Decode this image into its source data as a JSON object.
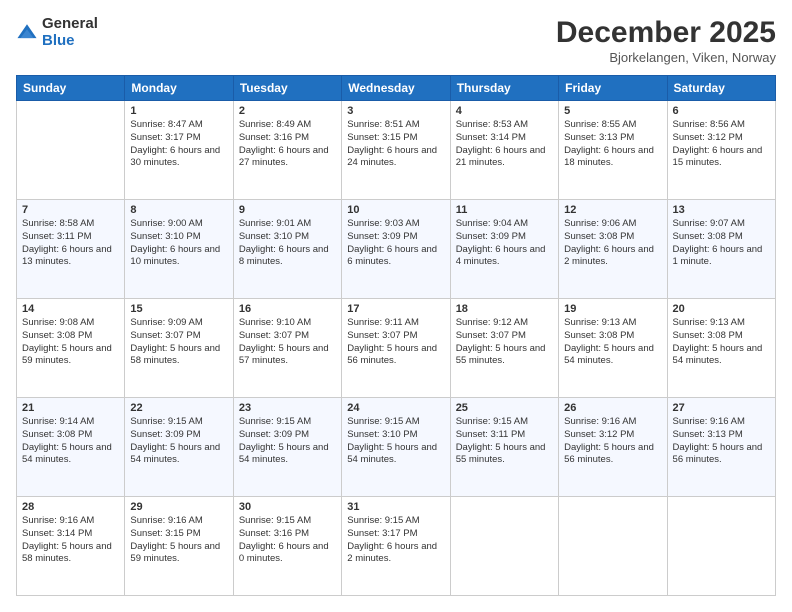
{
  "header": {
    "logo": {
      "general": "General",
      "blue": "Blue"
    },
    "title": "December 2025",
    "location": "Bjorkelangen, Viken, Norway"
  },
  "days_of_week": [
    "Sunday",
    "Monday",
    "Tuesday",
    "Wednesday",
    "Thursday",
    "Friday",
    "Saturday"
  ],
  "weeks": [
    [
      {
        "day": "",
        "sunrise": "",
        "sunset": "",
        "daylight": ""
      },
      {
        "day": "1",
        "sunrise": "Sunrise: 8:47 AM",
        "sunset": "Sunset: 3:17 PM",
        "daylight": "Daylight: 6 hours and 30 minutes."
      },
      {
        "day": "2",
        "sunrise": "Sunrise: 8:49 AM",
        "sunset": "Sunset: 3:16 PM",
        "daylight": "Daylight: 6 hours and 27 minutes."
      },
      {
        "day": "3",
        "sunrise": "Sunrise: 8:51 AM",
        "sunset": "Sunset: 3:15 PM",
        "daylight": "Daylight: 6 hours and 24 minutes."
      },
      {
        "day": "4",
        "sunrise": "Sunrise: 8:53 AM",
        "sunset": "Sunset: 3:14 PM",
        "daylight": "Daylight: 6 hours and 21 minutes."
      },
      {
        "day": "5",
        "sunrise": "Sunrise: 8:55 AM",
        "sunset": "Sunset: 3:13 PM",
        "daylight": "Daylight: 6 hours and 18 minutes."
      },
      {
        "day": "6",
        "sunrise": "Sunrise: 8:56 AM",
        "sunset": "Sunset: 3:12 PM",
        "daylight": "Daylight: 6 hours and 15 minutes."
      }
    ],
    [
      {
        "day": "7",
        "sunrise": "Sunrise: 8:58 AM",
        "sunset": "Sunset: 3:11 PM",
        "daylight": "Daylight: 6 hours and 13 minutes."
      },
      {
        "day": "8",
        "sunrise": "Sunrise: 9:00 AM",
        "sunset": "Sunset: 3:10 PM",
        "daylight": "Daylight: 6 hours and 10 minutes."
      },
      {
        "day": "9",
        "sunrise": "Sunrise: 9:01 AM",
        "sunset": "Sunset: 3:10 PM",
        "daylight": "Daylight: 6 hours and 8 minutes."
      },
      {
        "day": "10",
        "sunrise": "Sunrise: 9:03 AM",
        "sunset": "Sunset: 3:09 PM",
        "daylight": "Daylight: 6 hours and 6 minutes."
      },
      {
        "day": "11",
        "sunrise": "Sunrise: 9:04 AM",
        "sunset": "Sunset: 3:09 PM",
        "daylight": "Daylight: 6 hours and 4 minutes."
      },
      {
        "day": "12",
        "sunrise": "Sunrise: 9:06 AM",
        "sunset": "Sunset: 3:08 PM",
        "daylight": "Daylight: 6 hours and 2 minutes."
      },
      {
        "day": "13",
        "sunrise": "Sunrise: 9:07 AM",
        "sunset": "Sunset: 3:08 PM",
        "daylight": "Daylight: 6 hours and 1 minute."
      }
    ],
    [
      {
        "day": "14",
        "sunrise": "Sunrise: 9:08 AM",
        "sunset": "Sunset: 3:08 PM",
        "daylight": "Daylight: 5 hours and 59 minutes."
      },
      {
        "day": "15",
        "sunrise": "Sunrise: 9:09 AM",
        "sunset": "Sunset: 3:07 PM",
        "daylight": "Daylight: 5 hours and 58 minutes."
      },
      {
        "day": "16",
        "sunrise": "Sunrise: 9:10 AM",
        "sunset": "Sunset: 3:07 PM",
        "daylight": "Daylight: 5 hours and 57 minutes."
      },
      {
        "day": "17",
        "sunrise": "Sunrise: 9:11 AM",
        "sunset": "Sunset: 3:07 PM",
        "daylight": "Daylight: 5 hours and 56 minutes."
      },
      {
        "day": "18",
        "sunrise": "Sunrise: 9:12 AM",
        "sunset": "Sunset: 3:07 PM",
        "daylight": "Daylight: 5 hours and 55 minutes."
      },
      {
        "day": "19",
        "sunrise": "Sunrise: 9:13 AM",
        "sunset": "Sunset: 3:08 PM",
        "daylight": "Daylight: 5 hours and 54 minutes."
      },
      {
        "day": "20",
        "sunrise": "Sunrise: 9:13 AM",
        "sunset": "Sunset: 3:08 PM",
        "daylight": "Daylight: 5 hours and 54 minutes."
      }
    ],
    [
      {
        "day": "21",
        "sunrise": "Sunrise: 9:14 AM",
        "sunset": "Sunset: 3:08 PM",
        "daylight": "Daylight: 5 hours and 54 minutes."
      },
      {
        "day": "22",
        "sunrise": "Sunrise: 9:15 AM",
        "sunset": "Sunset: 3:09 PM",
        "daylight": "Daylight: 5 hours and 54 minutes."
      },
      {
        "day": "23",
        "sunrise": "Sunrise: 9:15 AM",
        "sunset": "Sunset: 3:09 PM",
        "daylight": "Daylight: 5 hours and 54 minutes."
      },
      {
        "day": "24",
        "sunrise": "Sunrise: 9:15 AM",
        "sunset": "Sunset: 3:10 PM",
        "daylight": "Daylight: 5 hours and 54 minutes."
      },
      {
        "day": "25",
        "sunrise": "Sunrise: 9:15 AM",
        "sunset": "Sunset: 3:11 PM",
        "daylight": "Daylight: 5 hours and 55 minutes."
      },
      {
        "day": "26",
        "sunrise": "Sunrise: 9:16 AM",
        "sunset": "Sunset: 3:12 PM",
        "daylight": "Daylight: 5 hours and 56 minutes."
      },
      {
        "day": "27",
        "sunrise": "Sunrise: 9:16 AM",
        "sunset": "Sunset: 3:13 PM",
        "daylight": "Daylight: 5 hours and 56 minutes."
      }
    ],
    [
      {
        "day": "28",
        "sunrise": "Sunrise: 9:16 AM",
        "sunset": "Sunset: 3:14 PM",
        "daylight": "Daylight: 5 hours and 58 minutes."
      },
      {
        "day": "29",
        "sunrise": "Sunrise: 9:16 AM",
        "sunset": "Sunset: 3:15 PM",
        "daylight": "Daylight: 5 hours and 59 minutes."
      },
      {
        "day": "30",
        "sunrise": "Sunrise: 9:15 AM",
        "sunset": "Sunset: 3:16 PM",
        "daylight": "Daylight: 6 hours and 0 minutes."
      },
      {
        "day": "31",
        "sunrise": "Sunrise: 9:15 AM",
        "sunset": "Sunset: 3:17 PM",
        "daylight": "Daylight: 6 hours and 2 minutes."
      },
      {
        "day": "",
        "sunrise": "",
        "sunset": "",
        "daylight": ""
      },
      {
        "day": "",
        "sunrise": "",
        "sunset": "",
        "daylight": ""
      },
      {
        "day": "",
        "sunrise": "",
        "sunset": "",
        "daylight": ""
      }
    ]
  ]
}
